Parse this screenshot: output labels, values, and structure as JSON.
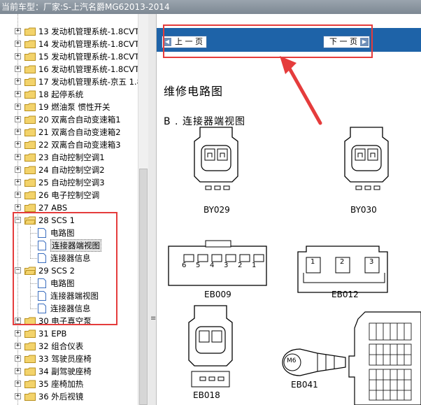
{
  "window": {
    "title": "当前车型：厂家:S-上汽名爵MG62013-2014"
  },
  "tree": {
    "items": [
      {
        "num": "13",
        "label": "发动机管理系统-1.8CVT"
      },
      {
        "num": "14",
        "label": "发动机管理系统-1.8CVT"
      },
      {
        "num": "15",
        "label": "发动机管理系统-1.8CVT"
      },
      {
        "num": "16",
        "label": "发动机管理系统-1.8CVT"
      },
      {
        "num": "17",
        "label": "发动机管理系统-京五 1.8"
      },
      {
        "num": "18",
        "label": "起停系统"
      },
      {
        "num": "19",
        "label": "燃油泵 惯性开关"
      },
      {
        "num": "20",
        "label": "双离合自动变速箱1"
      },
      {
        "num": "21",
        "label": "双离合自动变速箱2"
      },
      {
        "num": "22",
        "label": "双离合自动变速箱3"
      },
      {
        "num": "23",
        "label": "自动控制空调1"
      },
      {
        "num": "24",
        "label": "自动控制空调2"
      },
      {
        "num": "25",
        "label": "自动控制空调3"
      },
      {
        "num": "26",
        "label": "电子控制空调"
      },
      {
        "num": "27",
        "label": "ABS"
      },
      {
        "num": "28",
        "label": "SCS 1"
      },
      {
        "num": "29",
        "label": "SCS 2"
      },
      {
        "num": "30",
        "label": "电子真空泵"
      },
      {
        "num": "31",
        "label": "EPB"
      },
      {
        "num": "32",
        "label": "组合仪表"
      },
      {
        "num": "33",
        "label": "驾驶员座椅"
      },
      {
        "num": "34",
        "label": "副驾驶座椅"
      },
      {
        "num": "35",
        "label": "座椅加热"
      },
      {
        "num": "36",
        "label": "外后视镜"
      }
    ],
    "scs1_children": [
      "电路图",
      "连接器端视图",
      "连接器信息"
    ],
    "scs2_children": [
      "电路图",
      "连接器端视图",
      "连接器信息"
    ],
    "expand_plus": "+",
    "expand_minus": "−"
  },
  "document": {
    "prev_button": "上 一 页",
    "next_button": "下 一 页",
    "title": "维修电路图",
    "section": "B . 连接器端视图",
    "connectors": {
      "by029": "BY029",
      "by030": "BY030",
      "eb009": "EB009",
      "eb012": "EB012",
      "eb018": "EB018",
      "eb041": "EB041",
      "m6": "M6"
    },
    "eb009_pins": [
      "6",
      "5",
      "4",
      "3",
      "2",
      "1"
    ],
    "eb012_pins": [
      "1",
      "2",
      "3"
    ]
  },
  "colors": {
    "nav_blue": "#1e63a8",
    "highlight_red": "#e53c3c",
    "folder_yellow": "#f3d36b"
  },
  "icons": [
    "folder-icon",
    "document-icon",
    "prev-arrow-icon",
    "next-arrow-icon",
    "splitter-grip-icon"
  ]
}
